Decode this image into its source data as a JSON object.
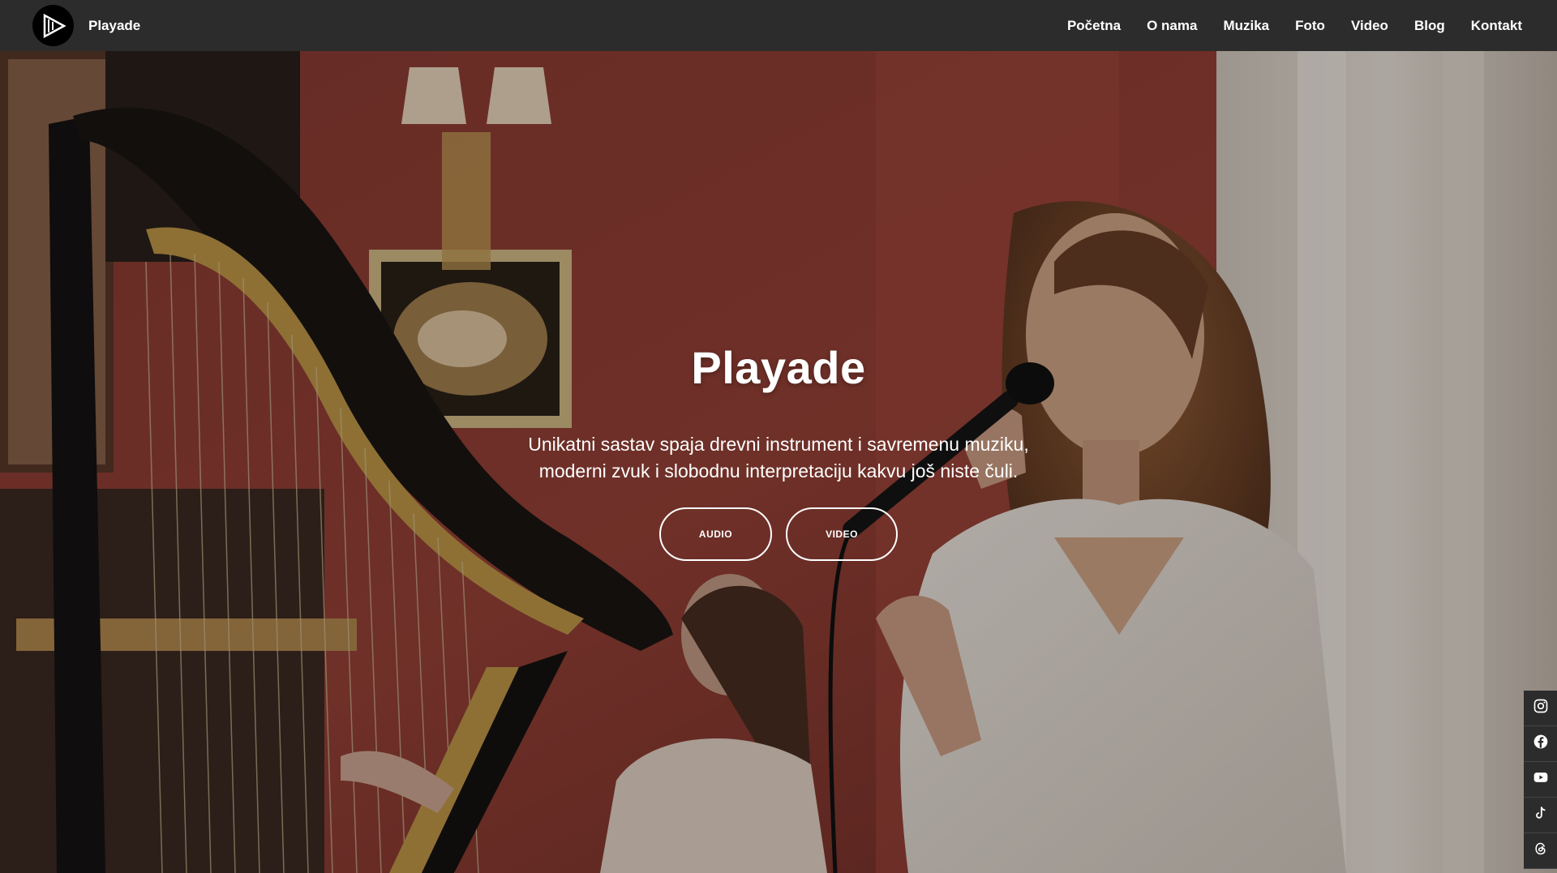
{
  "header": {
    "brand": "Playade",
    "logo_icon": "play-triangle-logo-icon",
    "nav": [
      {
        "label": "Početna"
      },
      {
        "label": "O nama"
      },
      {
        "label": "Muzika"
      },
      {
        "label": "Foto"
      },
      {
        "label": "Video"
      },
      {
        "label": "Blog"
      },
      {
        "label": "Kontakt"
      }
    ]
  },
  "hero": {
    "title": "Playade",
    "tagline_line1": "Unikatni sastav spaja drevni instrument i savremenu muziku,",
    "tagline_line2": "moderni zvuk i slobodnu interpretaciju kakvu još niste čuli.",
    "buttons": {
      "audio": "AUDIO",
      "video": "VIDEO"
    }
  },
  "social": [
    {
      "icon": "instagram-icon"
    },
    {
      "icon": "facebook-icon"
    },
    {
      "icon": "youtube-icon"
    },
    {
      "icon": "tiktok-icon"
    },
    {
      "icon": "threads-icon"
    }
  ],
  "colors": {
    "navbar": "#2c2c2c",
    "text": "#ffffff"
  }
}
